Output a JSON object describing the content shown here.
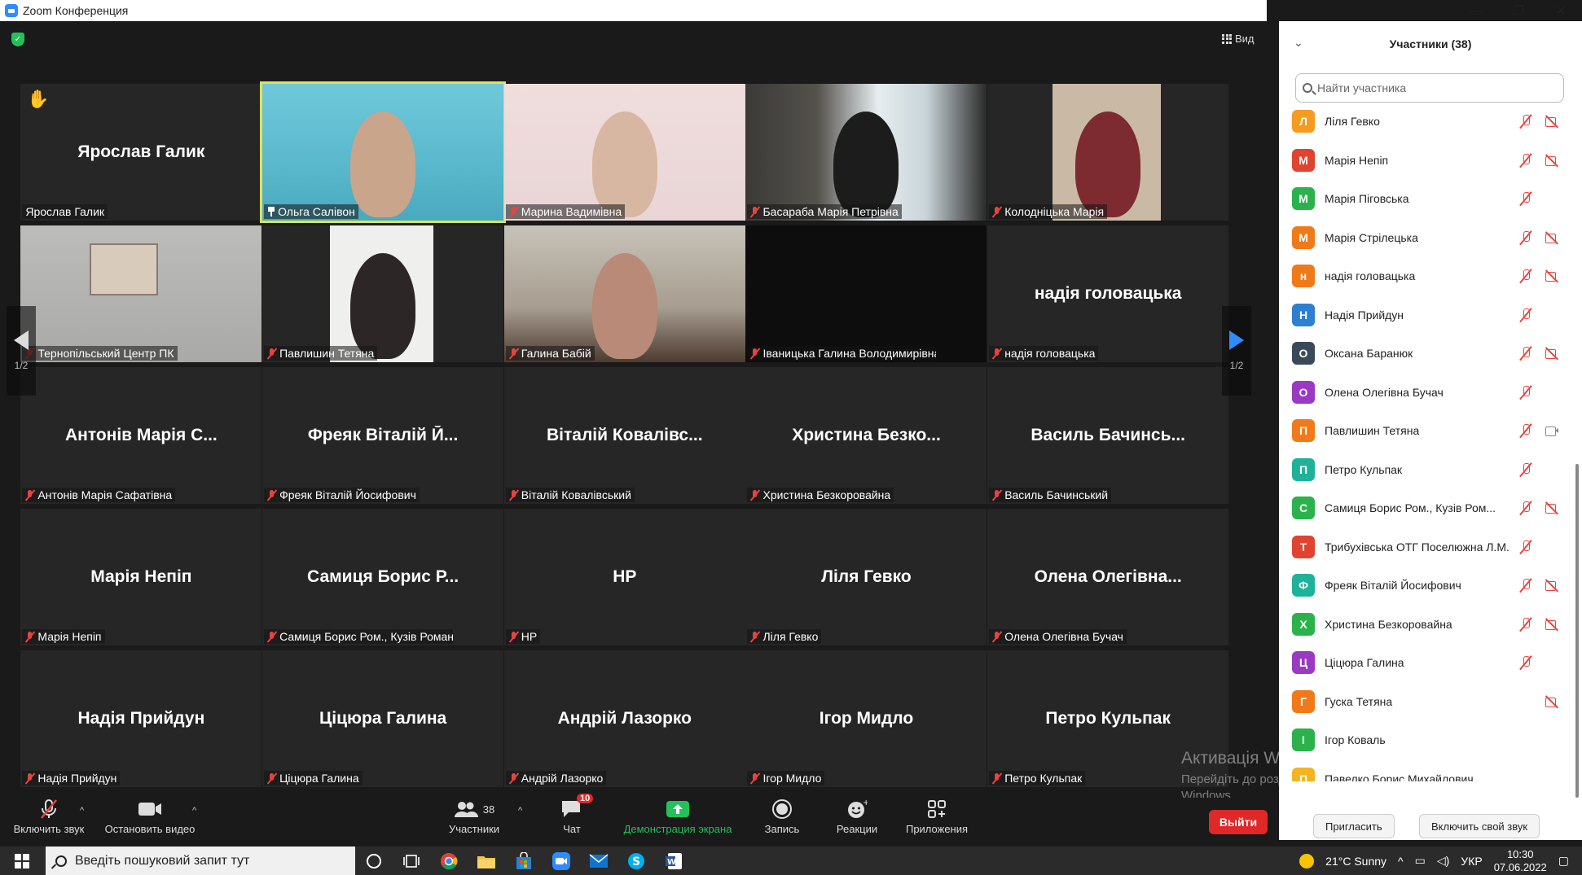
{
  "window": {
    "title": "Zoom Конференция",
    "min": "—",
    "max": "❐",
    "close": "✕"
  },
  "view_label": "Вид",
  "tiles": [
    {
      "big": "Ярослав Галик",
      "label": "Ярослав Галик",
      "hand": true,
      "muted": false
    },
    {
      "big": "",
      "label": "Ольга Салівон",
      "pinned": true,
      "active": true,
      "video": "v1"
    },
    {
      "big": "",
      "label": "Марина Вадимівна",
      "muted": true,
      "video": "v2"
    },
    {
      "big": "",
      "label": "Басараба Марія Петрівна",
      "muted": true,
      "video": "v3"
    },
    {
      "big": "",
      "label": "Колодніцька Марія",
      "muted": true,
      "video": "v4"
    },
    {
      "big": "",
      "label": "Тернопільський Центр ПК",
      "muted": true,
      "video": "v5"
    },
    {
      "big": "",
      "label": "Павлишин Тетяна",
      "muted": true,
      "video": "v6"
    },
    {
      "big": "",
      "label": "Галина Бабій",
      "muted": true,
      "video": "v7"
    },
    {
      "big": "",
      "label": "Іваницька Галина Володимирівна Н...",
      "muted": true,
      "video": "v8"
    },
    {
      "big": "надія головацька",
      "label": "надія головацька",
      "muted": true
    },
    {
      "big": "Антонів Марія С...",
      "label": "Антонів Марія Сафатівна",
      "muted": true
    },
    {
      "big": "Фреяк Віталій Й...",
      "label": "Фреяк Віталій Йосифович",
      "muted": true
    },
    {
      "big": "Віталій Ковалівс...",
      "label": "Віталій Ковалівський",
      "muted": true
    },
    {
      "big": "Христина Безко...",
      "label": "Христина Безкоровайна",
      "muted": true
    },
    {
      "big": "Василь Бачинсь...",
      "label": "Василь Бачинський",
      "muted": true
    },
    {
      "big": "Марія Непіп",
      "label": "Марія Непіп",
      "muted": true
    },
    {
      "big": "Самиця Борис Р...",
      "label": "Самиця Борис Ром., Кузів Роман Яр...",
      "muted": true
    },
    {
      "big": "НР",
      "label": "НР",
      "muted": true
    },
    {
      "big": "Ліля Гевко",
      "label": "Ліля Гевко",
      "muted": true
    },
    {
      "big": "Олена Олегівна...",
      "label": "Олена Олегівна Бучач",
      "muted": true
    },
    {
      "big": "Надія Прийдун",
      "label": "Надія Прийдун",
      "muted": true
    },
    {
      "big": "Ціцюра Галина",
      "label": "Ціцюра Галина",
      "muted": true
    },
    {
      "big": "Андрій Лазорко",
      "label": "Андрій Лазорко",
      "muted": true
    },
    {
      "big": "Ігор Мидло",
      "label": "Ігор Мидло",
      "muted": true
    },
    {
      "big": "Петро Кульпак",
      "label": "Петро Кульпак",
      "muted": true
    }
  ],
  "pager": {
    "left": "1/2",
    "right": "1/2"
  },
  "toolbar": {
    "unmute": "Включить звук",
    "video": "Остановить видео",
    "participants": "Участники",
    "participants_count": "38",
    "chat": "Чат",
    "chat_badge": "10",
    "share": "Демонстрация экрана",
    "record": "Запись",
    "reactions": "Реакции",
    "apps": "Приложения",
    "leave": "Выйти"
  },
  "panel": {
    "title": "Участники (38)",
    "search_placeholder": "Найти участника",
    "invite": "Пригласить",
    "unmute_me": "Включить свой звук",
    "participants": [
      {
        "initial": "Л",
        "name": "Ліля Гевко",
        "color": "#f59b1f",
        "mic": "muted",
        "cam": "off"
      },
      {
        "initial": "М",
        "name": "Марія Непіп",
        "color": "#e0432f",
        "mic": "muted",
        "cam": "off"
      },
      {
        "initial": "М",
        "name": "Марія Піговська",
        "color": "#2bb24c",
        "mic": "muted",
        "cam": ""
      },
      {
        "initial": "М",
        "name": "Марія Стрілецька",
        "color": "#f07a1a",
        "mic": "muted",
        "cam": "off"
      },
      {
        "initial": "н",
        "name": "надія головацька",
        "color": "#f07a1a",
        "mic": "muted",
        "cam": "off"
      },
      {
        "initial": "Н",
        "name": "Надія Прийдун",
        "color": "#2d7fd0",
        "mic": "muted",
        "cam": ""
      },
      {
        "initial": "О",
        "name": "Оксана Баранюк",
        "color": "#3b4a59",
        "mic": "muted",
        "cam": "off"
      },
      {
        "initial": "О",
        "name": "Олена Олегівна Бучач",
        "color": "#9b39c2",
        "mic": "muted",
        "cam": ""
      },
      {
        "initial": "П",
        "name": "Павлишин Тетяна",
        "color": "#f07a1a",
        "mic": "muted",
        "cam": "on"
      },
      {
        "initial": "П",
        "name": "Петро Кульпак",
        "color": "#1fb29a",
        "mic": "muted",
        "cam": ""
      },
      {
        "initial": "С",
        "name": "Самиця Борис Ром., Кузів Ром...",
        "color": "#2bb24c",
        "mic": "muted",
        "cam": "off"
      },
      {
        "initial": "Т",
        "name": "Трибухівська ОТГ Поселюжна Л.М.",
        "color": "#e0432f",
        "mic": "muted",
        "cam": ""
      },
      {
        "initial": "Ф",
        "name": "Фреяк Віталій Йосифович",
        "color": "#1fb29a",
        "mic": "muted",
        "cam": "off"
      },
      {
        "initial": "Х",
        "name": "Христина Безкоровайна",
        "color": "#2bb24c",
        "mic": "muted",
        "cam": "off"
      },
      {
        "initial": "Ц",
        "name": "Ціцюра Галина",
        "color": "#9b39c2",
        "mic": "muted",
        "cam": ""
      },
      {
        "initial": "Г",
        "name": "Гуска Тетяна",
        "color": "#f07a1a",
        "mic": "",
        "cam": "off"
      },
      {
        "initial": "І",
        "name": "Ігор Коваль",
        "color": "#2bb24c",
        "mic": "",
        "cam": ""
      },
      {
        "initial": "П",
        "name": "Павелко Борис Михайлович",
        "color": "#f5b41f",
        "mic": "",
        "cam": ""
      }
    ]
  },
  "watermark": {
    "line1": "Активація Windows",
    "line2": "Перейдіть до розділу \"Настройки\", щоб активувати",
    "line3": "Windows."
  },
  "taskbar": {
    "search_text": "Введіть пошуковий запит тут",
    "weather": "21°C  Sunny",
    "lang": "УКР",
    "time": "10:30",
    "date": "07.06.2022"
  }
}
